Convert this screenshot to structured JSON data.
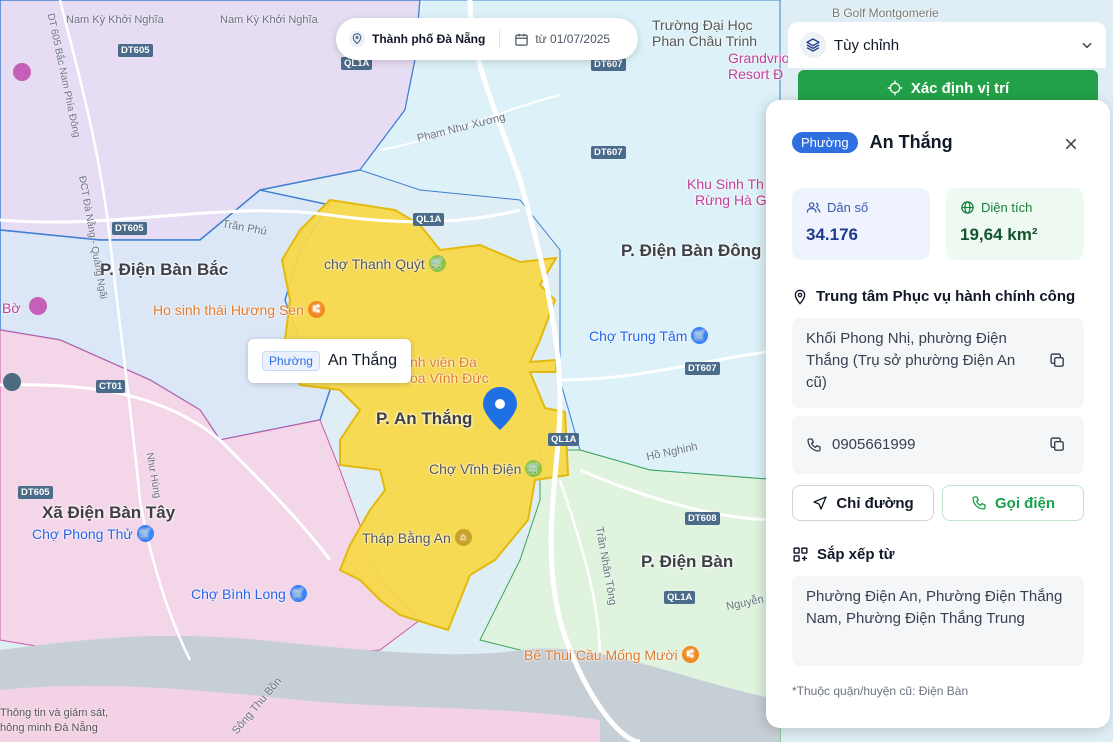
{
  "topbar": {
    "city": "Thành phố Đà Nẵng",
    "date": "từ 01/07/2025"
  },
  "controls": {
    "customize_label": "Tùy chỉnh",
    "locate_label": "Xác định vị trí"
  },
  "panel": {
    "badge": "Phường",
    "title": "An Thắng",
    "population_label": "Dân số",
    "population_value": "34.176",
    "area_label": "Diện tích",
    "area_value": "19,64 km²",
    "center_heading": "Trung tâm Phục vụ hành chính công",
    "address": "Khối Phong Nhị, phường Điện Thắng (Trụ sở phường Điện An cũ)",
    "phone": "0905661999",
    "directions_label": "Chỉ đường",
    "call_label": "Gọi điện",
    "merged_heading": "Sắp xếp từ",
    "merged_from": "Phường Điện An, Phường Điện Thắng Nam, Phường Điện Thắng Trung",
    "footnote": "*Thuộc quận/huyện cũ: Điện Bàn"
  },
  "tooltip": {
    "badge": "Phường",
    "name": "An Thắng"
  },
  "map": {
    "areas": [
      {
        "name": "P. Điện Bàn Bắc"
      },
      {
        "name": "P. Điện Bàn Đông"
      },
      {
        "name": "P. An Thắng"
      },
      {
        "name": "Xã Điện Bàn Tây"
      },
      {
        "name": "P. Điện Bàn"
      }
    ],
    "pois": [
      {
        "name": "chợ Thanh Quýt",
        "kind": "market"
      },
      {
        "name": "Ho sinh thái Hương Sen",
        "kind": "food"
      },
      {
        "name": "Chợ Trung Tâm",
        "kind": "market"
      },
      {
        "name": "Chợ Vĩnh Điện",
        "kind": "market"
      },
      {
        "name": "Tháp Bằng An",
        "kind": "landmark"
      },
      {
        "name": "Chợ Phong Thử",
        "kind": "market"
      },
      {
        "name": "Chợ Bình Long",
        "kind": "market"
      },
      {
        "name": "Bê Thui Cầu Mống Mười",
        "kind": "food"
      },
      {
        "name": "Khu Sinh Th",
        "kind": "park"
      },
      {
        "name": "Rừng Hà G",
        "kind": "park"
      },
      {
        "name": "Trường Đại Học",
        "kind": "school"
      },
      {
        "name": "Phan Châu Trinh",
        "kind": "school"
      },
      {
        "name": "Grandvrio",
        "kind": "hotel"
      },
      {
        "name": "Resort Đ",
        "kind": "hotel"
      },
      {
        "name": "nh viện Đa",
        "kind": "hospital"
      },
      {
        "name": "oa Vĩnh Đức",
        "kind": "hospital"
      },
      {
        "name": "Bờ",
        "kind": "other"
      },
      {
        "name": "B Golf Montgomerie",
        "kind": "other"
      }
    ],
    "roads": [
      {
        "name": "DT605"
      },
      {
        "name": "DT605"
      },
      {
        "name": "DT605"
      },
      {
        "name": "QL1A"
      },
      {
        "name": "QL1A"
      },
      {
        "name": "QL1A"
      },
      {
        "name": "QL1A"
      },
      {
        "name": "DT607"
      },
      {
        "name": "DT607"
      },
      {
        "name": "DT607"
      },
      {
        "name": "CT01"
      },
      {
        "name": "DT608"
      }
    ],
    "road_names": [
      {
        "name": "Nam Kỳ Khởi Nghĩa"
      },
      {
        "name": "Nam Kỳ Khởi Nghĩa"
      },
      {
        "name": "Phạm Như Xương"
      },
      {
        "name": "Trần Phú"
      },
      {
        "name": "Trần Nhân Tông"
      },
      {
        "name": "Nguyễn Đ"
      },
      {
        "name": "Hồ Nghinh"
      },
      {
        "name": "Sông Thu Bồn"
      },
      {
        "name": "ĐCT Đà Nẵng - Quảng Ngãi"
      },
      {
        "name": "DT 605 Bắc Nam Phía Đông"
      },
      {
        "name": "Như Hùng"
      }
    ],
    "credit_line1": "Thông tin và giám sát,",
    "credit_line2": "hông minh Đà Nẵng"
  }
}
